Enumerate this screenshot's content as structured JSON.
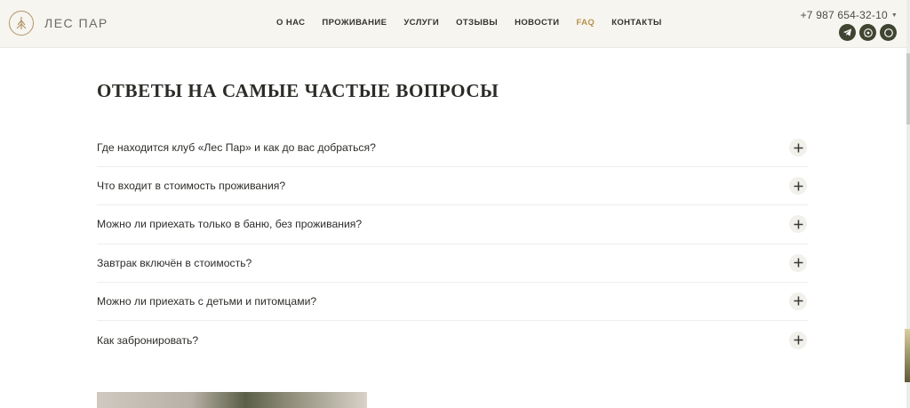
{
  "header": {
    "logo_text": "ЛЕС ПАР",
    "nav": [
      {
        "label": "О НАС",
        "active": false
      },
      {
        "label": "ПРОЖИВАНИЕ",
        "active": false
      },
      {
        "label": "УСЛУГИ",
        "active": false
      },
      {
        "label": "ОТЗЫВЫ",
        "active": false
      },
      {
        "label": "НОВОСТИ",
        "active": false
      },
      {
        "label": "FAQ",
        "active": true
      },
      {
        "label": "КОНТАКТЫ",
        "active": false
      }
    ],
    "phone": "+7 987 654-32-10",
    "socials": [
      "telegram-icon",
      "whatsapp-icon",
      "chat-icon"
    ]
  },
  "faq": {
    "title": "ОТВЕТЫ НА САМЫЕ ЧАСТЫЕ ВОПРОСЫ",
    "items": [
      {
        "question": "Где находится клуб «Лес Пар» и как до вас добраться?"
      },
      {
        "question": "Что входит в стоимость проживания?"
      },
      {
        "question": "Можно ли приехать только в баню, без проживания?"
      },
      {
        "question": "Завтрак включён в стоимость?"
      },
      {
        "question": "Можно ли приехать с детьми и питомцами?"
      },
      {
        "question": "Как забронировать?"
      }
    ]
  },
  "colors": {
    "accent": "#b7924e",
    "header_bg": "#f6f5f0",
    "social_bg": "#3f4530"
  }
}
